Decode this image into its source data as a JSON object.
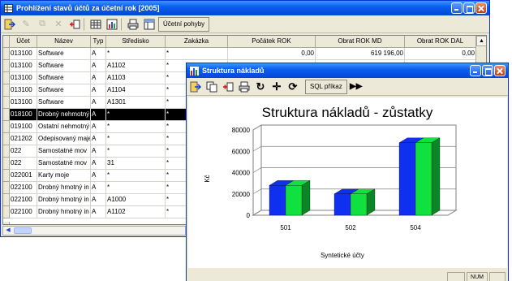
{
  "main_window": {
    "title": "Prohlížení stavů účtů za účetní rok [2005]",
    "toolbar": {
      "ucetni_pohyby_label": "Účetní pohyby"
    },
    "columns": [
      "Účet",
      "Název",
      "Typ",
      "Středisko",
      "Zakázka",
      "Počátek ROK",
      "Obrat ROK MD",
      "Obrat ROK DAL"
    ],
    "rows": [
      [
        "013100",
        "Software",
        "A",
        "*",
        "*",
        "0,00",
        "619 196,00",
        "0,00"
      ],
      [
        "013100",
        "Software",
        "A",
        "A1102",
        "*",
        "",
        "",
        ""
      ],
      [
        "013100",
        "Software",
        "A",
        "A1103",
        "*",
        "",
        "",
        ""
      ],
      [
        "013100",
        "Software",
        "A",
        "A1104",
        "*",
        "",
        "",
        ""
      ],
      [
        "013100",
        "Software",
        "A",
        "A1301",
        "*",
        "",
        "",
        ""
      ],
      [
        "018100",
        "Drobný nehmotný",
        "A",
        "*",
        "*",
        "",
        "",
        ""
      ],
      [
        "019100",
        "Ostatní nehmotný",
        "A",
        "*",
        "*",
        "",
        "",
        ""
      ],
      [
        "021202",
        "Odepisovaný maje",
        "A",
        "*",
        "*",
        "",
        "",
        ""
      ],
      [
        "022",
        "Samostatné mov",
        "A",
        "*",
        "*",
        "",
        "",
        ""
      ],
      [
        "022",
        "Samostatné mov",
        "A",
        "31",
        "*",
        "",
        "",
        ""
      ],
      [
        "022001",
        "Karty moje",
        "A",
        "*",
        "*",
        "",
        "",
        ""
      ],
      [
        "022100",
        "Drobný hmotný in",
        "A",
        "*",
        "*",
        "",
        "",
        ""
      ],
      [
        "022100",
        "Drobný hmotný in",
        "A",
        "A1000",
        "*",
        "",
        "",
        ""
      ],
      [
        "022100",
        "Drobný hmotný in",
        "A",
        "A1102",
        "*",
        "",
        "",
        ""
      ]
    ],
    "selected_row": 5,
    "new_row_marker": "→"
  },
  "chart_window": {
    "title": "Struktura nákladů",
    "toolbar": {
      "sql_label": "SQL příkaz"
    },
    "status": {
      "num": "NUM"
    }
  },
  "chart_data": {
    "type": "bar",
    "title": "Struktura nákladů - zůstatky",
    "xlabel": "Syntetické účty",
    "ylabel": "Kč",
    "categories": [
      "501",
      "502",
      "504"
    ],
    "series": [
      {
        "values": [
          28000,
          20000,
          68000
        ],
        "color": "#1030f0"
      },
      {
        "values": [
          28000,
          20000,
          68000
        ],
        "color": "#10e040"
      }
    ],
    "ylim": [
      0,
      80000
    ],
    "yticks": [
      0,
      20000,
      40000,
      60000,
      80000
    ],
    "grid": true,
    "view": "3d"
  }
}
